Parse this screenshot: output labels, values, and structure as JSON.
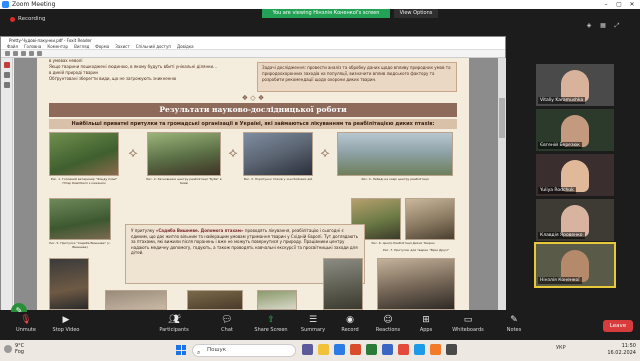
{
  "window": {
    "title": "Zoom Meeting"
  },
  "header": {
    "recording_label": "Recording",
    "viewing_banner": "You are viewing Нінзлія Коненкої's screen",
    "view_options_label": "View Options"
  },
  "shared_screen": {
    "app_title": "Pretty-Чудові-пакунки.pdf - Foxit Reader",
    "menu": [
      "Файл",
      "Головна",
      "Коментар",
      "Вигляд",
      "Форма",
      "Захист",
      "Спільний доступ",
      "Довідка"
    ],
    "top_left_text": [
      "в умовах неволі",
      "Якщо тварини пошкоджені людиною, в якому будуть вбиті унікальні ділянки…",
      "в дикій природі тварин",
      "Обґрунтовані зберегти види, що не загрожують зникненню"
    ],
    "top_right_text": "Задачі дослідження: провести аналіз та обробку даних щодо впливу природних умов та природоохоронних заходів на популяції, визначити вплив людського фактору та розробити рекомендації щодо охорони диких тварин.",
    "section_title": "Результати науково-дослідницької роботи",
    "section_subtitle": "Найбільші приватні притулки та громадські організації в Україні, які займаються лікуванням та реабілітацією диких птахів:",
    "captions": {
      "c1": "Рис. 1. Головний ветеринар \"Фонду Сови\" Пітер Кемпбелл з кажаном",
      "c2": "Рис. 2. Засновники центру реабілітації \"Буба\" в Києві",
      "c3": "Рис. 3. Порятунок птахів у зоні бойових дій",
      "c4": "Рис. 4. Лебеді на озері центру реабілітації",
      "c5": "Рис. 5. Притулок \"Садиба Вишневе\" (с. Вишневе)",
      "c6": "Рис. 6. Центр Реабілітації Диких Тварин",
      "c7": "Рис. 7. Притулок для тварин \"Вірні Друзі\""
    },
    "center_text_intro": "У притулку ",
    "center_text_highlight": "«Садиба Вишневе. Допомога птахам»",
    "center_text_body": " проводять лікування, реабілітацію і сьогодні є єдиним, що дає житло вільним та найкращим умовам утримання тварин у Східній Європі. Тут доглядають за птахами, які вижили після поранень і вже не можуть повернутися у природу. Працівники центру надають медичну допомогу, годують, а також проводять навчальні екскурсії та просвітницькі заходи для дітей."
  },
  "participants": [
    {
      "name": "Vitaliy Karamushka",
      "face_color": "#d9b29c",
      "bg": "#4a4a4a"
    },
    {
      "name": "Євгеній Березюк",
      "face_color": "#c49a7e",
      "bg": "#2c3a2c"
    },
    {
      "name": "Yuliya Rodchuk",
      "face_color": "#e0b89a",
      "bg": "#3a2e2e"
    },
    {
      "name": "Клавдія Яровенко",
      "face_color": "#d8b4a0",
      "bg": "#3e3a34"
    },
    {
      "name": "Нінзлія Коненкої",
      "face_color": "#b48a6a",
      "bg": "#5a5a48"
    }
  ],
  "toolbar": {
    "unmute": "Unmute",
    "stop_video": "Stop Video",
    "participants": "Participants",
    "participants_count": "5",
    "chat": "Chat",
    "share_screen": "Share Screen",
    "summary": "Summary",
    "record": "Record",
    "reactions": "Reactions",
    "apps": "Apps",
    "whiteboards": "Whiteboards",
    "notes": "Notes",
    "leave": "Leave"
  },
  "taskbar": {
    "weather_temp": "9°C",
    "weather_desc": "Fog",
    "search_placeholder": "Пошук",
    "language": "УКР",
    "time": "11:50",
    "date": "16.02.2024"
  },
  "colors": {
    "zoom_bg": "#1c1c1c",
    "banner_green": "#23a154",
    "leave_red": "#d83b3b",
    "doc_bg": "#f4ecdc",
    "section_banner": "#8e6a5b",
    "active_speaker": "#e8c93c"
  }
}
